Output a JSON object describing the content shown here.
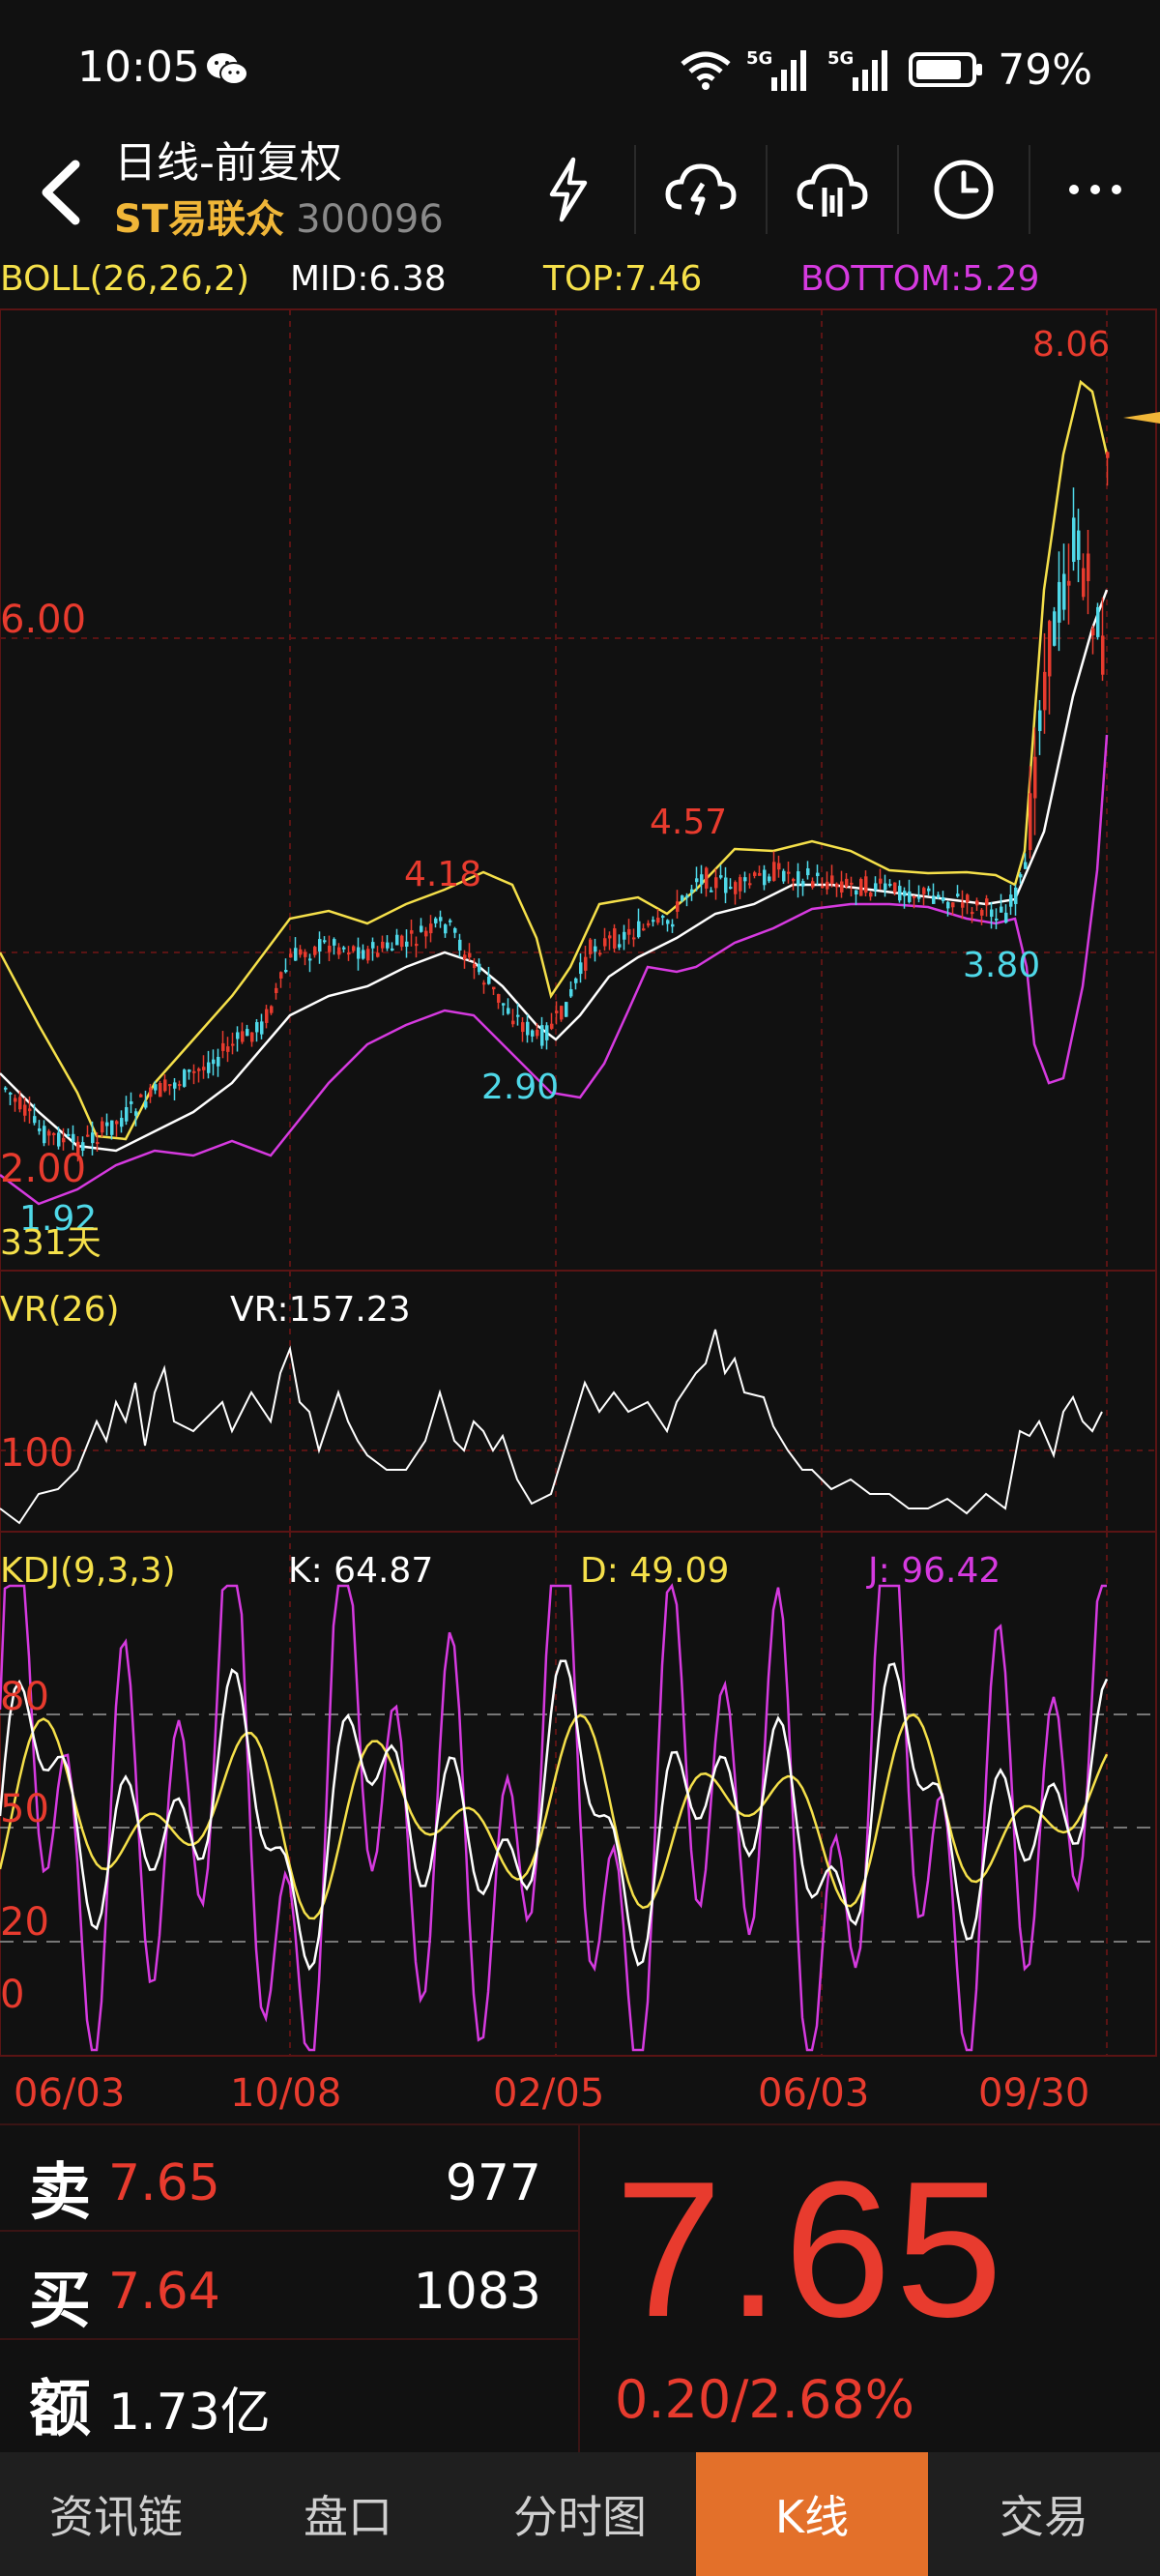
{
  "status": {
    "time": "10:05",
    "battery": "79%"
  },
  "header": {
    "title": "日线-前复权",
    "stock_name": "ST易联众",
    "stock_code": "300096"
  },
  "boll": {
    "label": "BOLL(26,26,2)",
    "mid": "MID:6.38",
    "top": "TOP:7.46",
    "bottom": "BOTTOM:5.29"
  },
  "main_chart": {
    "price_6": "6.00",
    "price_2": "2.00",
    "high_label": "8.06",
    "label_418": "4.18",
    "label_457": "4.57",
    "label_290": "2.90",
    "label_380": "3.80",
    "label_192": "1.92",
    "days": "331天"
  },
  "vr": {
    "label": "VR(26)",
    "value": "VR:157.23",
    "level": "100"
  },
  "kdj": {
    "label": "KDJ(9,3,3)",
    "k": "K: 64.87",
    "d": "D: 49.09",
    "j": "J: 96.42",
    "l80": "80",
    "l50": "50",
    "l20": "20",
    "l0": "0"
  },
  "dates": [
    "06/03",
    "10/08",
    "02/05",
    "06/03",
    "09/30"
  ],
  "quote": {
    "sell_tag": "卖",
    "sell_price": "7.65",
    "sell_vol": "977",
    "buy_tag": "买",
    "buy_price": "7.64",
    "buy_vol": "1083",
    "amount_tag": "额",
    "amount": "1.73亿",
    "last_price": "7.65",
    "change": "0.20/2.68%"
  },
  "tabs": [
    "资讯链",
    "盘口",
    "分时图",
    "K线",
    "交易"
  ],
  "colors": {
    "up": "#e83b2e",
    "down": "#4fd8e8",
    "boll_top": "#f5e04a",
    "boll_bottom": "#d63ae0",
    "accent": "#e3702a"
  }
}
